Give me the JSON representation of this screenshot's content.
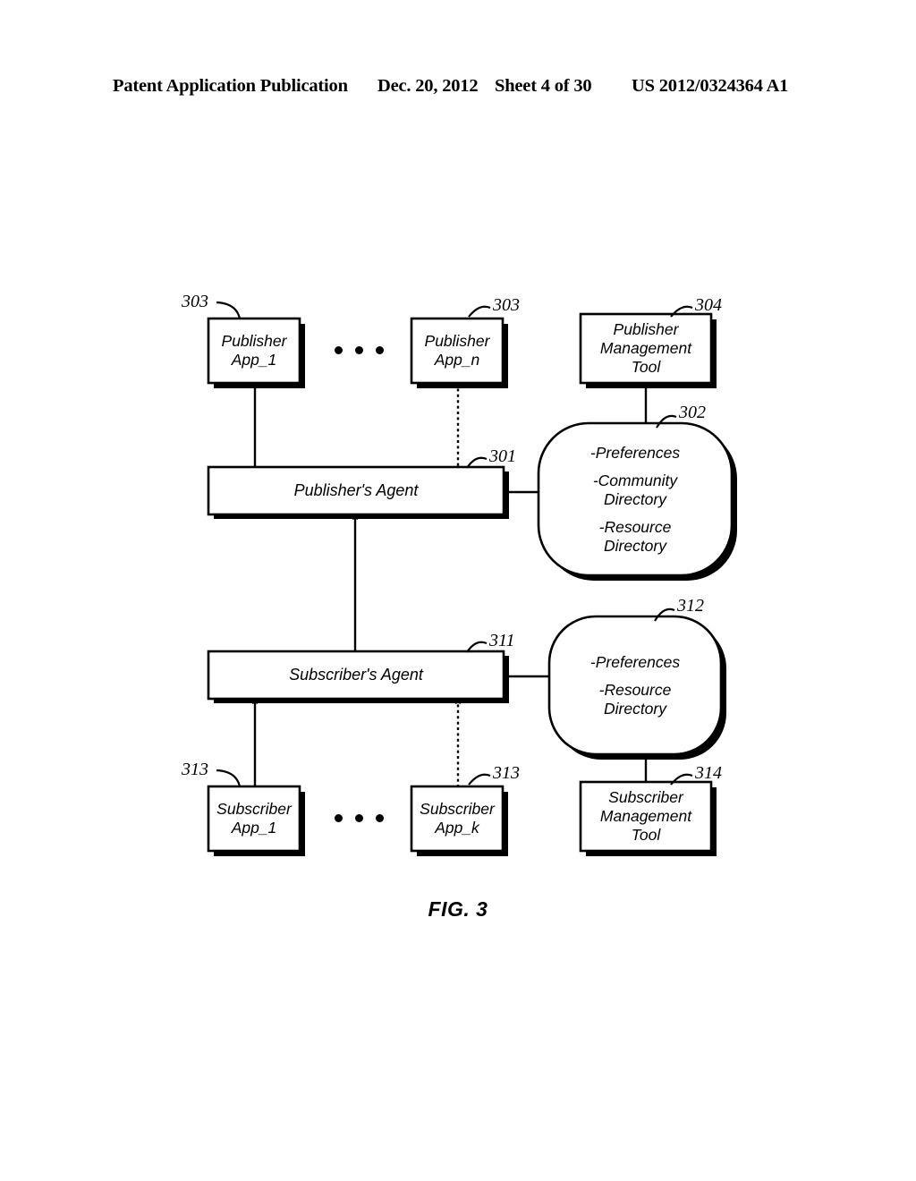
{
  "header": {
    "publication": "Patent Application Publication",
    "date": "Dec. 20, 2012",
    "sheet": "Sheet 4 of 30",
    "patent_number": "US 2012/0324364 A1"
  },
  "figure": {
    "caption": "FIG. 3",
    "colors": {
      "stroke": "#000000",
      "fill": "#ffffff",
      "shadow": "#000000"
    },
    "nodes": {
      "publisher_app_1": {
        "label": "Publisher\nApp_1",
        "ref": "303"
      },
      "publisher_app_n": {
        "label": "Publisher\nApp_n",
        "ref": "303"
      },
      "publisher_management_tool": {
        "label": "Publisher\nManagement\nTool",
        "ref": "304"
      },
      "publishers_agent": {
        "label": "Publisher's Agent",
        "ref": "301"
      },
      "publisher_store": {
        "ref": "302",
        "items": [
          "-Preferences",
          "-Community\nDirectory",
          "-Resource\nDirectory"
        ]
      },
      "subscribers_agent": {
        "label": "Subscriber's Agent",
        "ref": "311"
      },
      "subscriber_store": {
        "ref": "312",
        "items": [
          "-Preferences",
          "-Resource\nDirectory"
        ]
      },
      "subscriber_app_1": {
        "label": "Subscriber\nApp_1",
        "ref": "313"
      },
      "subscriber_app_k": {
        "label": "Subscriber\nApp_k",
        "ref": "313"
      },
      "subscriber_management_tool": {
        "label": "Subscriber\nManagement\nTool",
        "ref": "314"
      }
    },
    "ellipsis": {
      "top": "• • •",
      "bottom": "• • •"
    }
  }
}
